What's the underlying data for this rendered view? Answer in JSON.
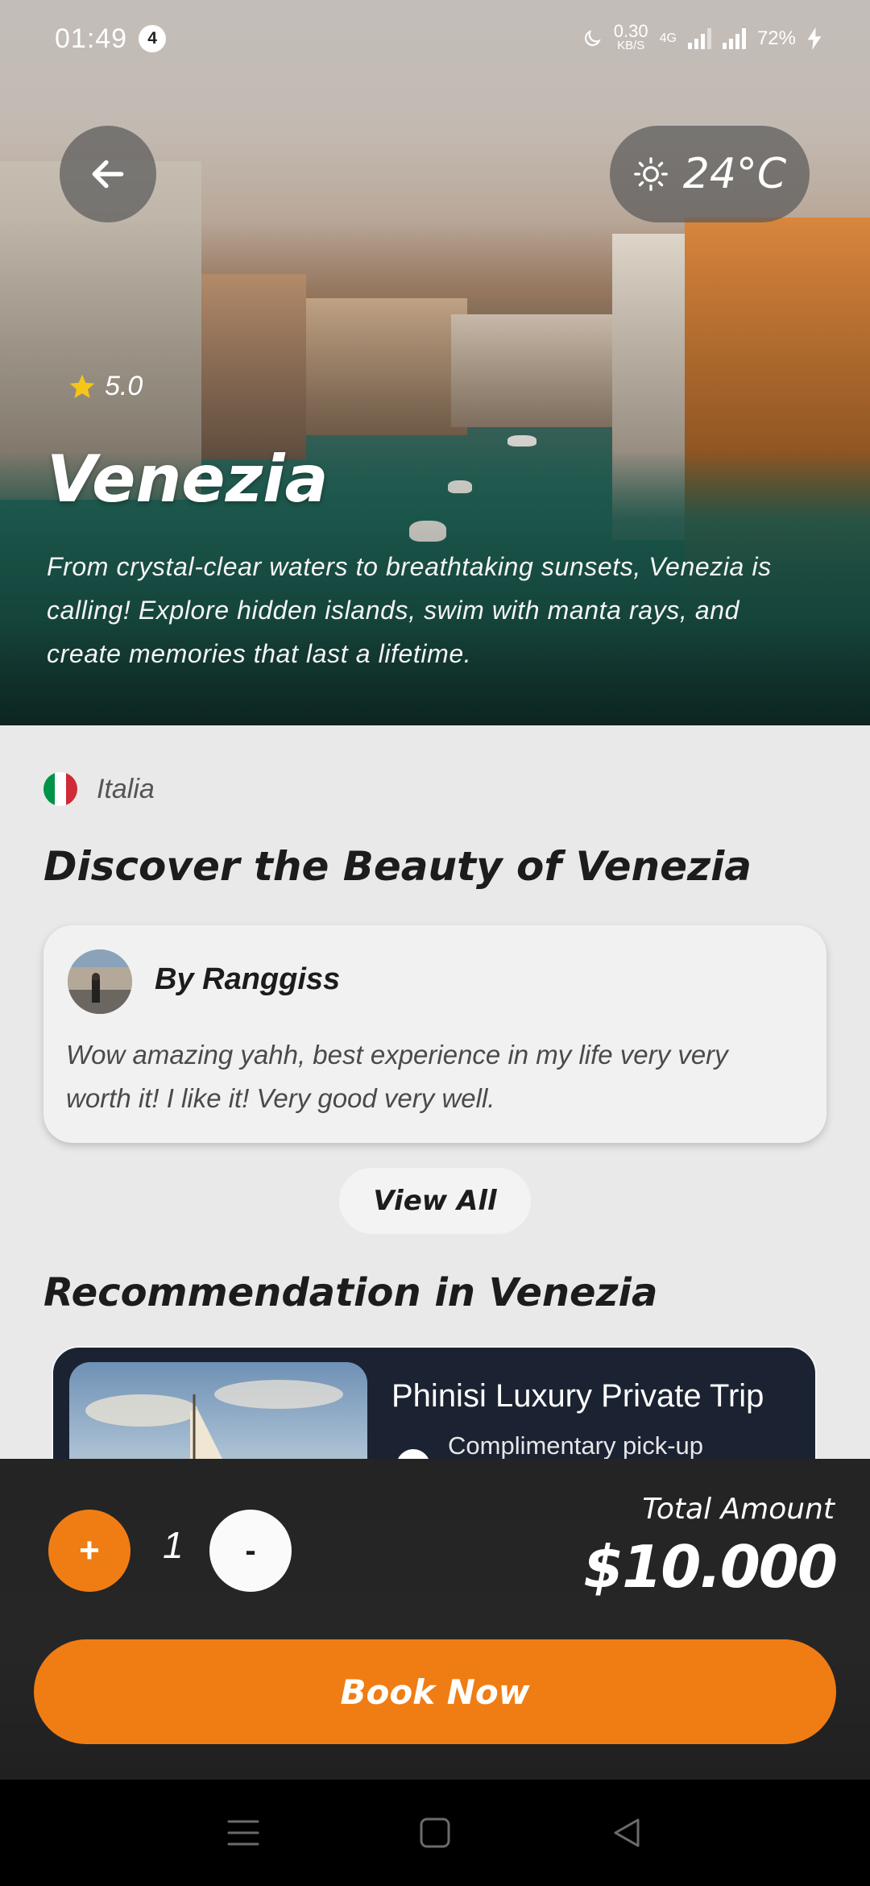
{
  "status_bar": {
    "time": "01:49",
    "notification_count": "4",
    "net_speed_value": "0.30",
    "net_speed_unit": "KB/S",
    "network_type": "4G",
    "battery": "72%"
  },
  "hero": {
    "temperature": "24°C",
    "rating": "5.0",
    "title": "Venezia",
    "description": "From crystal-clear waters to breathtaking sunsets, Venezia is calling! Explore hidden islands, swim with manta rays, and create memories that last a lifetime."
  },
  "location": {
    "country": "Italia",
    "flag_colors": [
      "#009246",
      "#ffffff",
      "#ce2b37"
    ]
  },
  "discover": {
    "title": "Discover the Beauty of Venezia"
  },
  "review": {
    "author": "By Ranggiss",
    "text": "Wow amazing yahh, best experience in my life very very worth it! I like it! Very good very well."
  },
  "view_all_label": "View All",
  "recommendation": {
    "section_title": "Recommendation in Venezia",
    "card_title": "Phinisi Luxury Private Trip",
    "feature": "Complimentary pick-up"
  },
  "booking": {
    "plus_label": "+",
    "quantity": "1",
    "minus_label": "-",
    "total_label": "Total Amount",
    "total_value": "$10.000",
    "book_label": "Book Now"
  },
  "colors": {
    "accent": "#f07d14",
    "booking_bar": "#242424",
    "card_dark": "#1b2332"
  },
  "icons": {
    "back": "arrow-left-icon",
    "weather": "sun-icon",
    "rating": "star-icon",
    "nav_menu": "menu-icon",
    "nav_home": "square-icon",
    "nav_back": "triangle-back-icon"
  }
}
